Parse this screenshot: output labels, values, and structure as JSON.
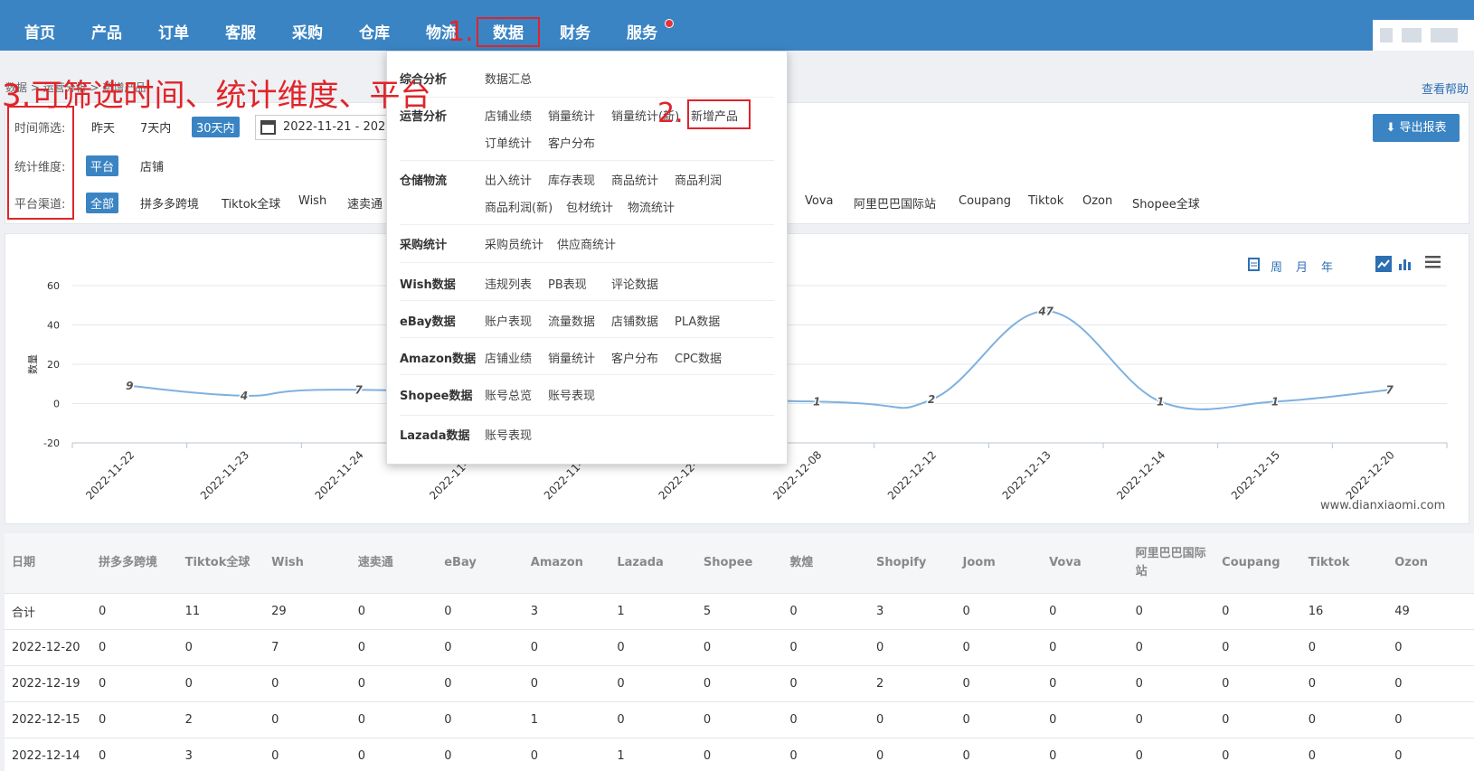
{
  "nav": {
    "items": [
      "首页",
      "产品",
      "订单",
      "客服",
      "采购",
      "仓库",
      "物流",
      "数据",
      "财务",
      "服务"
    ]
  },
  "annotations": {
    "step1": "1.",
    "step2": "2.",
    "step3": "3.可筛选时间、统计维度、平台"
  },
  "breadcrumb": [
    "数据",
    "运营分析",
    "新增产品"
  ],
  "help_link": "查看帮助",
  "filters": {
    "time_label": "时间筛选:",
    "time_options": [
      "昨天",
      "7天内",
      "30天内"
    ],
    "date_range": "2022-11-21 - 2022-12-20",
    "dimension_label": "统计维度:",
    "dimension_options": [
      "平台",
      "店铺"
    ],
    "platform_label": "平台渠道:",
    "platform_options_left": [
      "全部",
      "拼多多跨境",
      "Tiktok全球",
      "Wish",
      "速卖通"
    ],
    "platform_options_right": [
      "Vova",
      "阿里巴巴国际站",
      "Coupang",
      "Tiktok",
      "Ozon",
      "Shopee全球"
    ],
    "export_label": "导出报表"
  },
  "chart_tools": {
    "period": [
      "周",
      "月",
      "年"
    ]
  },
  "watermark": "www.dianxiaomi.com",
  "chart_data": {
    "type": "line",
    "ylabel": "数量",
    "ylim": [
      -20,
      60
    ],
    "yticks": [
      -20,
      0,
      20,
      40,
      60
    ],
    "categories": [
      "2022-11-22",
      "2022-11-23",
      "2022-11-24",
      "2022-11-25",
      "2022-11-26",
      "2022-12-01",
      "2022-12-08",
      "2022-12-12",
      "2022-12-13",
      "2022-12-14",
      "2022-12-15",
      "2022-12-20"
    ],
    "values": [
      9,
      4,
      7,
      null,
      null,
      null,
      1,
      2,
      47,
      1,
      1,
      7
    ],
    "grid": true,
    "color": "#7fb1df"
  },
  "dropdown": {
    "groups": [
      {
        "title": "综合分析",
        "links": [
          "数据汇总"
        ]
      },
      {
        "title": "运营分析",
        "links": [
          "店铺业绩",
          "销量统计",
          "销量统计(新)",
          "新增产品",
          "订单统计",
          "客户分布"
        ]
      },
      {
        "title": "仓储物流",
        "links": [
          "出入统计",
          "库存表现",
          "商品统计",
          "商品利润",
          "商品利润(新)",
          "包材统计",
          "物流统计"
        ]
      },
      {
        "title": "采购统计",
        "links": [
          "采购员统计",
          "供应商统计"
        ]
      },
      {
        "title": "Wish数据",
        "links": [
          "违规列表",
          "PB表现",
          "评论数据"
        ]
      },
      {
        "title": "eBay数据",
        "links": [
          "账户表现",
          "流量数据",
          "店铺数据",
          "PLA数据"
        ]
      },
      {
        "title": "Amazon数据",
        "links": [
          "店铺业绩",
          "销量统计",
          "客户分布",
          "CPC数据"
        ]
      },
      {
        "title": "Shopee数据",
        "links": [
          "账号总览",
          "账号表现"
        ]
      },
      {
        "title": "Lazada数据",
        "links": [
          "账号表现"
        ]
      }
    ]
  },
  "table": {
    "headers": [
      "日期",
      "拼多多跨境",
      "Tiktok全球",
      "Wish",
      "速卖通",
      "eBay",
      "Amazon",
      "Lazada",
      "Shopee",
      "敦煌",
      "Shopify",
      "Joom",
      "Vova",
      "阿里巴巴国际站",
      "Coupang",
      "Tiktok",
      "Ozon"
    ],
    "rows": [
      [
        "合计",
        "0",
        "11",
        "29",
        "0",
        "0",
        "3",
        "1",
        "5",
        "0",
        "3",
        "0",
        "0",
        "0",
        "0",
        "16",
        "49"
      ],
      [
        "2022-12-20",
        "0",
        "0",
        "7",
        "0",
        "0",
        "0",
        "0",
        "0",
        "0",
        "0",
        "0",
        "0",
        "0",
        "0",
        "0",
        "0"
      ],
      [
        "2022-12-19",
        "0",
        "0",
        "0",
        "0",
        "0",
        "0",
        "0",
        "0",
        "0",
        "2",
        "0",
        "0",
        "0",
        "0",
        "0",
        "0"
      ],
      [
        "2022-12-15",
        "0",
        "2",
        "0",
        "0",
        "0",
        "1",
        "0",
        "0",
        "0",
        "0",
        "0",
        "0",
        "0",
        "0",
        "0",
        "0"
      ],
      [
        "2022-12-14",
        "0",
        "3",
        "0",
        "0",
        "0",
        "0",
        "1",
        "0",
        "0",
        "0",
        "0",
        "0",
        "0",
        "0",
        "0",
        "0"
      ]
    ]
  }
}
